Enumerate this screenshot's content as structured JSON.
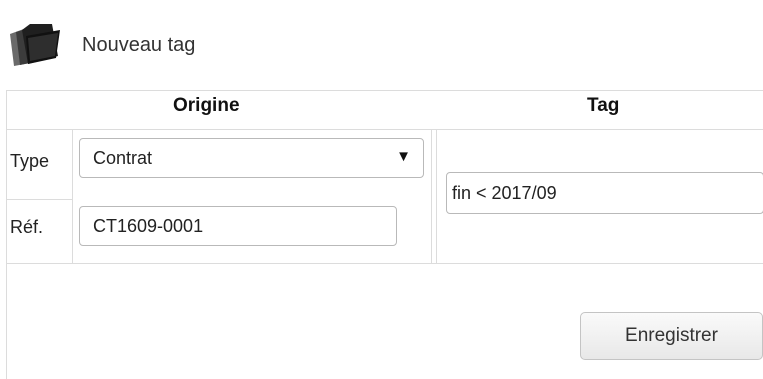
{
  "header": {
    "icon": "folder-stack-icon",
    "title": "Nouveau tag"
  },
  "table": {
    "origine_header": "Origine",
    "tag_header": "Tag",
    "type_label": "Type",
    "type_value": "Contrat",
    "ref_label": "Réf.",
    "ref_value": "CT1609-0001",
    "tag_value": "fin < 2017/09"
  },
  "actions": {
    "save_label": "Enregistrer"
  },
  "colors": {
    "border": "#dcdcdc",
    "input_border": "#b9b9b9",
    "text": "#222222"
  }
}
